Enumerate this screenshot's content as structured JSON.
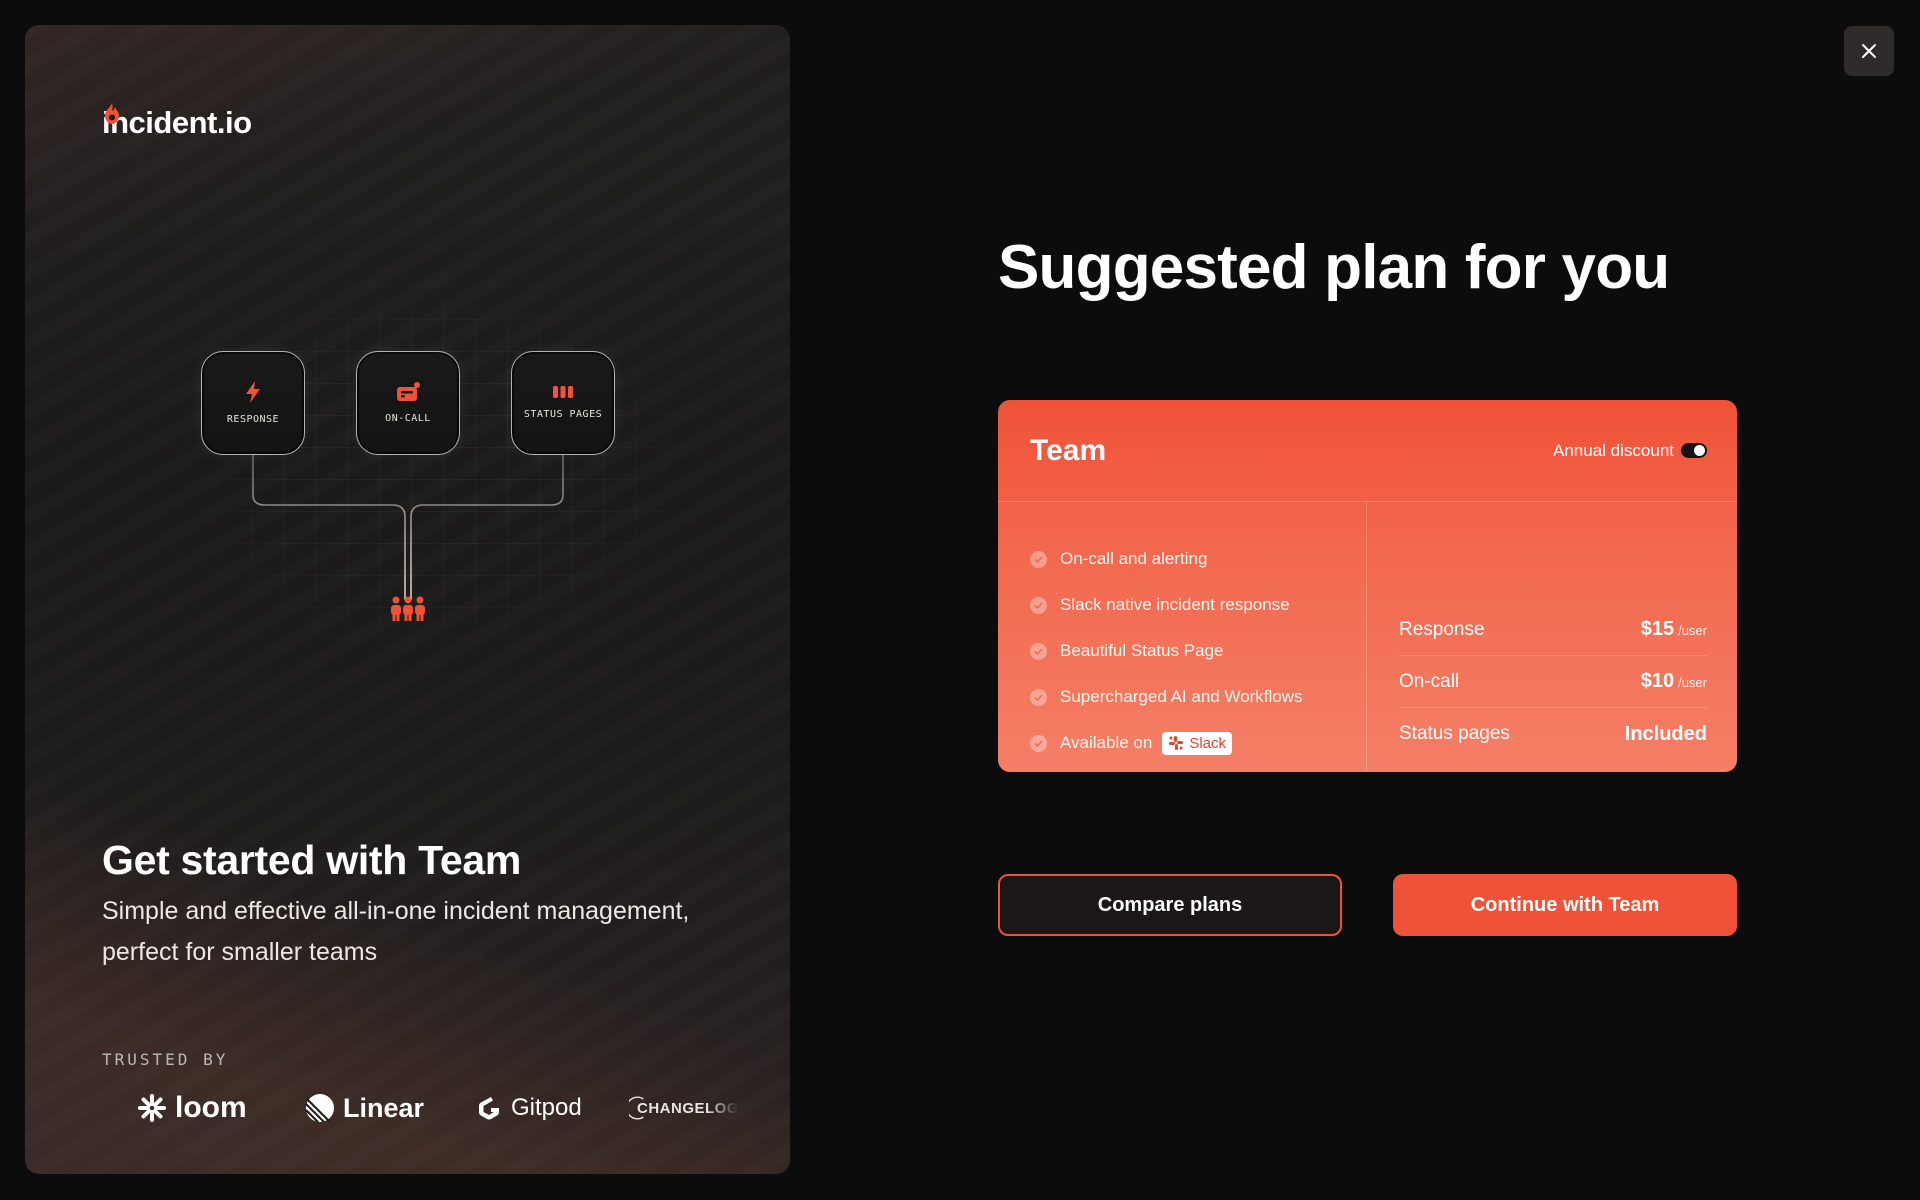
{
  "brand": {
    "name": "incident.io"
  },
  "promo": {
    "nodes": [
      {
        "label": "RESPONSE",
        "icon": "bolt-icon"
      },
      {
        "label": "ON-CALL",
        "icon": "pager-icon"
      },
      {
        "label": "STATUS PAGES",
        "icon": "status-bars-icon"
      }
    ],
    "title": "Get started with Team",
    "description": "Simple and effective all-in-one incident management, perfect for smaller teams",
    "trusted_by_label": "TRUSTED BY",
    "logos": [
      {
        "name": "loom"
      },
      {
        "name": "Linear"
      },
      {
        "name": "Gitpod"
      },
      {
        "name": "CHANGELOG"
      }
    ]
  },
  "main": {
    "headline": "Suggested plan for you",
    "plan": {
      "name": "Team",
      "annual_discount_label": "Annual discount",
      "annual_discount_on": true,
      "features": [
        "On-call and alerting",
        "Slack native incident response",
        "Beautiful Status Page",
        "Supercharged AI and Workflows",
        "Available on"
      ],
      "slack_badge": "Slack",
      "prices": [
        {
          "label": "Response",
          "value": "$15",
          "unit": "/user"
        },
        {
          "label": "On-call",
          "value": "$10",
          "unit": "/user"
        },
        {
          "label": "Status pages",
          "value": "Included",
          "unit": ""
        }
      ]
    },
    "buttons": {
      "compare": "Compare plans",
      "continue": "Continue with Team"
    }
  },
  "colors": {
    "accent": "#f05238",
    "background": "#0c0c0c",
    "panel": "#1c1b1b"
  }
}
